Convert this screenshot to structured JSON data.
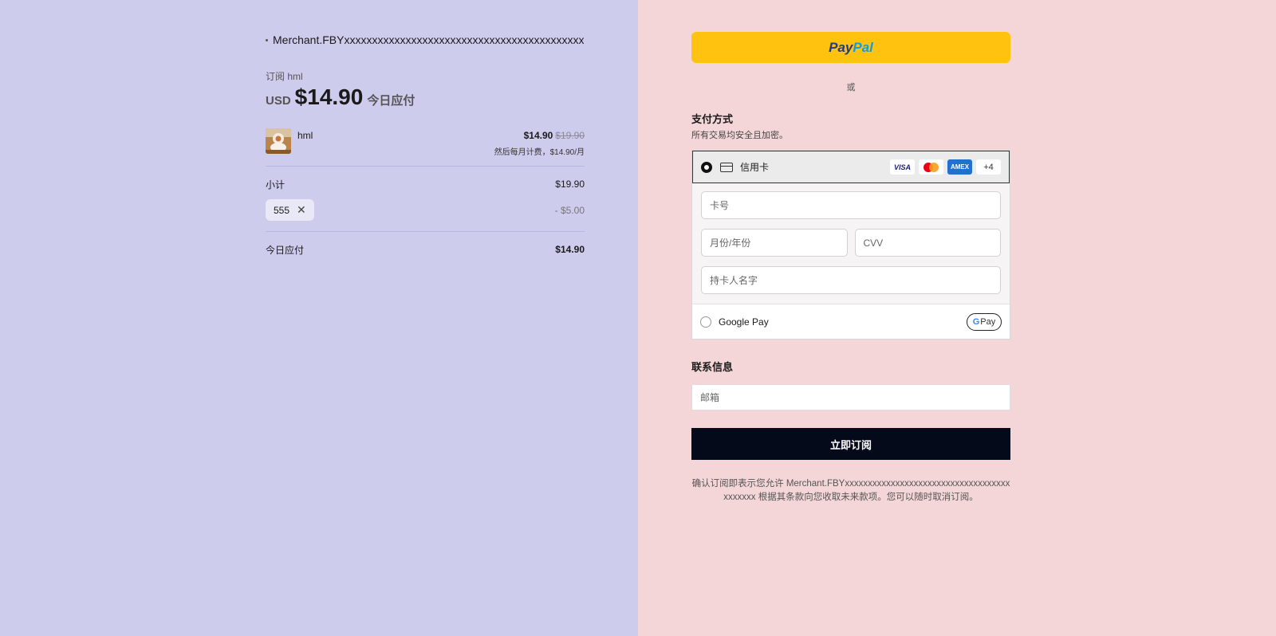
{
  "summary": {
    "merchant_name": "Merchant.FBYxxxxxxxxxxxxxxxxxxxxxxxxxxxxxxxxxxxxxxxxxxx",
    "subscribe_label": "订阅 hml",
    "currency": "USD",
    "amount": "$14.90",
    "amount_suffix": "今日应付",
    "item": {
      "name": "hml",
      "price": "$14.90",
      "original_price": "$19.90",
      "recurring_note": "然后每月计费，$14.90/月",
      "thumbnail_icon": "product-thumbnail"
    },
    "subtotal_label": "小计",
    "subtotal_value": "$19.90",
    "coupon_code": "555",
    "coupon_close_icon": "close-icon",
    "discount_value": "- $5.00",
    "total_label": "今日应付",
    "total_value": "$14.90"
  },
  "payment": {
    "paypal_part1": "Pay",
    "paypal_part2": "Pal",
    "or_text": "或",
    "section_title": "支付方式",
    "section_subtitle": "所有交易均安全且加密。",
    "card_option_label": "信用卡",
    "card_brands": {
      "visa": "VISA",
      "amex": "AMEX",
      "more": "+4"
    },
    "card_number_placeholder": "卡号",
    "expiry_placeholder": "月份/年份",
    "cvv_placeholder": "CVV",
    "cardholder_placeholder": "持卡人名字",
    "gpay_label": "Google Pay",
    "gpay_badge_g": "G",
    "gpay_badge_text": "Pay"
  },
  "contact": {
    "title": "联系信息",
    "email_placeholder": "邮箱"
  },
  "subscribe_button": "立即订阅",
  "legal_text": "确认订阅即表示您允许 Merchant.FBYxxxxxxxxxxxxxxxxxxxxxxxxxxxxxxxxxxxxxxxxxxx 根据其条款向您收取未来款项。您可以随时取消订阅。",
  "colors": {
    "left_bg": "#cdcced",
    "right_bg": "#f4d6d9",
    "paypal": "#ffc20e",
    "subscribe_bg": "#050a1a"
  }
}
